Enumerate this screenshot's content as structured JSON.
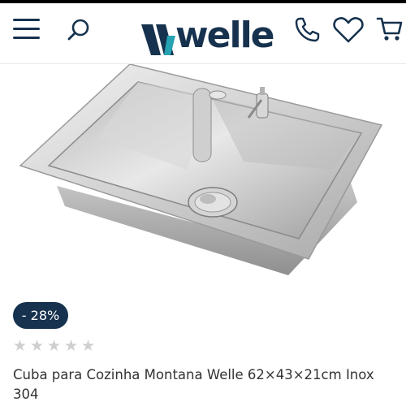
{
  "header": {
    "menu_icon": "hamburger-menu-icon",
    "search_icon": "search-icon",
    "logo_text": "welle",
    "phone_icon": "phone-icon",
    "wishlist_icon": "heart-icon",
    "cart_icon": "cart-icon"
  },
  "product": {
    "image_alt": "Cuba para Cozinha Montana Welle",
    "discount_label": "- 28%",
    "rating": {
      "value": 0,
      "max": 5
    },
    "title": "Cuba para Cozinha Montana Welle 62×43×21cm Inox 304"
  },
  "colors": {
    "brand_navy": "#16324e",
    "brand_teal": "#26a3b3",
    "star_empty": "#cfcfcf"
  }
}
